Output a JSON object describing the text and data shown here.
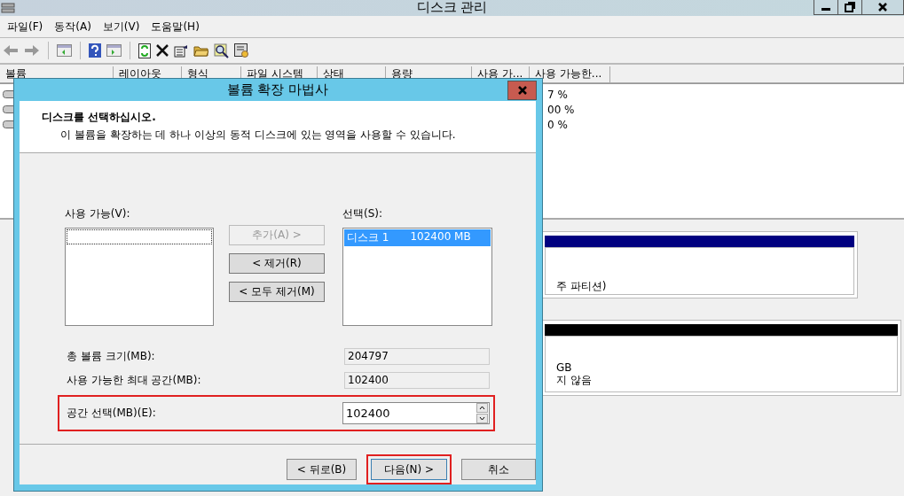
{
  "window": {
    "title": "디스크 관리"
  },
  "menu": [
    "파일(F)",
    "동작(A)",
    "보기(V)",
    "도움말(H)"
  ],
  "columns": [
    "볼륨",
    "레이아웃",
    "형식",
    "파일 시스템",
    "상태",
    "용량",
    "사용 가...",
    "사용 가능한..."
  ],
  "volume_rows": [
    {
      "column_8": "7 %"
    },
    {
      "column_8": "00 %"
    },
    {
      "column_8": "0 %"
    }
  ],
  "disks": [
    {
      "color": "#000080",
      "partition_lines": [
        "주 파티션)"
      ]
    },
    {
      "color": "#000000",
      "partition_lines": [
        "GB",
        "지 않음"
      ]
    }
  ],
  "dialog": {
    "title": "볼륨 확장 마법사",
    "heading": "디스크를 선택하십시오.",
    "subtitle": "이 볼륨을 확장하는 데 하나 이상의 동적 디스크에 있는 영역을 사용할 수 있습니다.",
    "available_label": "사용 가능(V):",
    "selected_label": "선택(S):",
    "move_buttons": [
      {
        "label": "추가(A) >",
        "disabled": true
      },
      {
        "label": "< 제거(R)",
        "disabled": false
      },
      {
        "label": "< 모두 제거(M)",
        "disabled": false
      }
    ],
    "selected_items": [
      {
        "disk": "디스크 1",
        "size": "102400 MB",
        "selected": true
      }
    ],
    "fields": [
      {
        "label": "총 볼륨 크기(MB):",
        "value": "204797",
        "kind": "readonly",
        "highlighted": false
      },
      {
        "label": "사용 가능한 최대 공간(MB):",
        "value": "102400",
        "kind": "readonly",
        "highlighted": false
      },
      {
        "label": "공간 선택(MB)(E):",
        "value": "102400",
        "kind": "spinner",
        "highlighted": true
      }
    ],
    "buttons": [
      {
        "label": "< 뒤로(B)",
        "highlighted": false
      },
      {
        "label": "다음(N) >",
        "highlighted": true
      },
      {
        "label": "취소",
        "highlighted": false
      }
    ]
  }
}
